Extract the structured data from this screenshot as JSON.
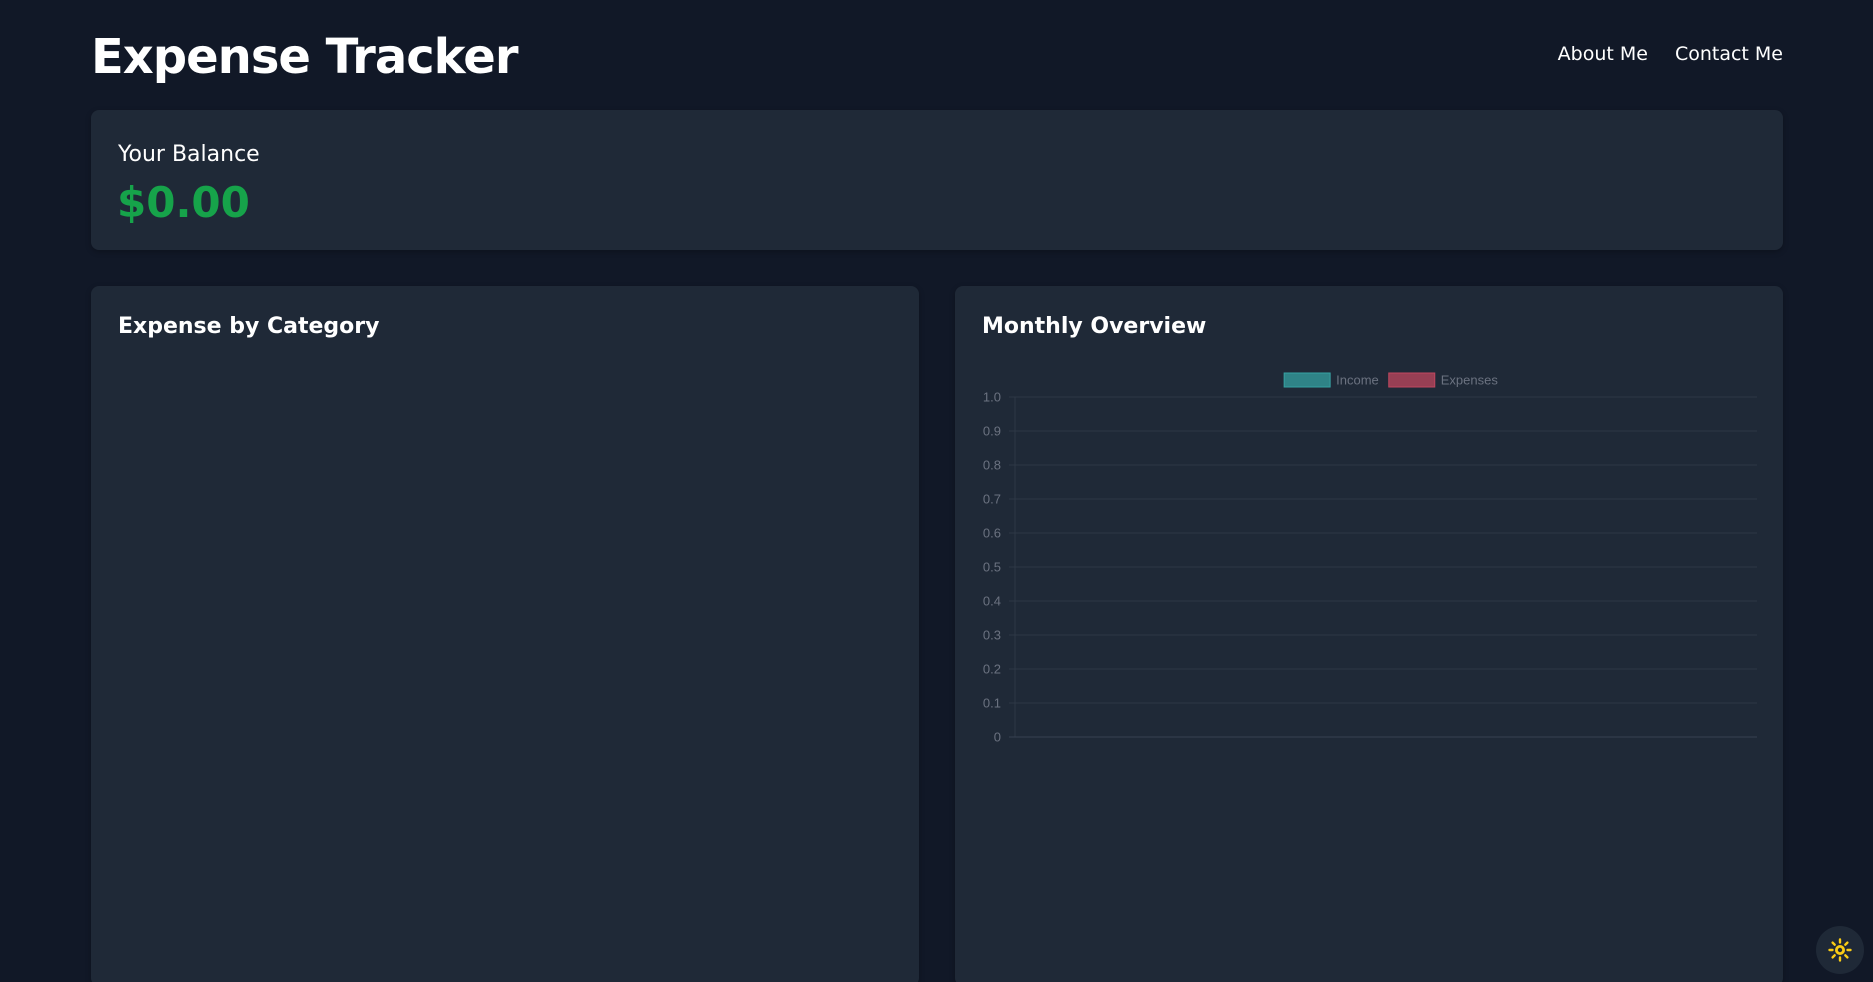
{
  "header": {
    "title": "Expense Tracker",
    "nav": [
      {
        "label": "About Me"
      },
      {
        "label": "Contact Me"
      }
    ]
  },
  "balance": {
    "label": "Your Balance",
    "amount": "$0.00",
    "amount_color": "#16a34a"
  },
  "category_panel": {
    "title": "Expense by Category"
  },
  "overview_panel": {
    "title": "Monthly Overview"
  },
  "theme_toggle": {
    "icon": "sun-icon",
    "color": "#facc15"
  },
  "chart_data": {
    "type": "bar",
    "title": "",
    "categories": [],
    "series": [
      {
        "name": "Income",
        "values": [],
        "color": "#36a2a3"
      },
      {
        "name": "Expenses",
        "values": [],
        "color": "#c0475f"
      }
    ],
    "y_ticks": [
      "0",
      "0.1",
      "0.2",
      "0.3",
      "0.4",
      "0.5",
      "0.6",
      "0.7",
      "0.8",
      "0.9",
      "1.0"
    ],
    "ylim": [
      0,
      1
    ],
    "grid": true,
    "legend_position": "top"
  }
}
